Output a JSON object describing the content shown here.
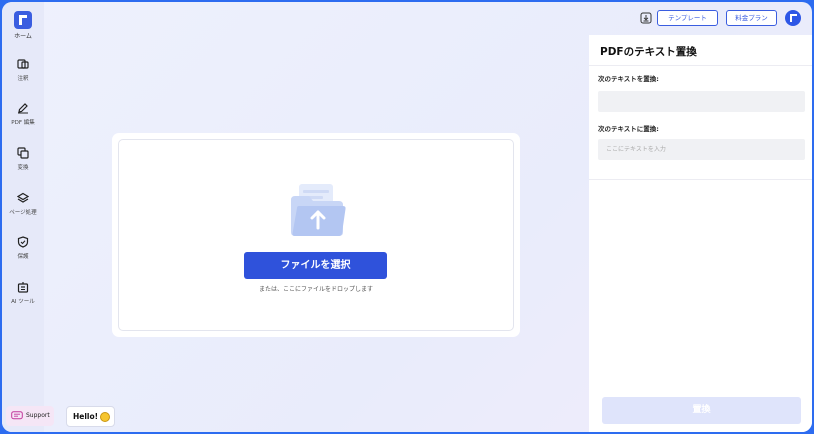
{
  "sidebar": {
    "home_label": "ホーム",
    "items": [
      {
        "label": "注釈",
        "icon": "annotate-icon"
      },
      {
        "label": "PDF 編集",
        "icon": "edit-pen-icon"
      },
      {
        "label": "変換",
        "icon": "convert-icon"
      },
      {
        "label": "ページ処理",
        "icon": "pages-layers-icon"
      },
      {
        "label": "保護",
        "icon": "shield-icon"
      },
      {
        "label": "AI ツール",
        "icon": "ai-tools-icon"
      }
    ]
  },
  "topbar": {
    "template_label": "テンプレート",
    "pricing_label": "料金プラン",
    "download_icon": "download-icon",
    "avatar_icon": "user-avatar-icon"
  },
  "dropzone": {
    "select_button": "ファイルを選択",
    "hint": "または、ここにファイルをドロップします"
  },
  "panel": {
    "title": "PDFのテキスト置換",
    "find_label": "次のテキストを置換:",
    "find_value": "",
    "replace_label": "次のテキストに置換:",
    "replace_placeholder": "ここにテキストを入力",
    "replace_button": "置換"
  },
  "widgets": {
    "support_label": "Support",
    "hello_label": "Hello!"
  },
  "colors": {
    "accent": "#2f52db",
    "border": "#2d6cf0",
    "disabled_button": "#dfe4fb"
  }
}
